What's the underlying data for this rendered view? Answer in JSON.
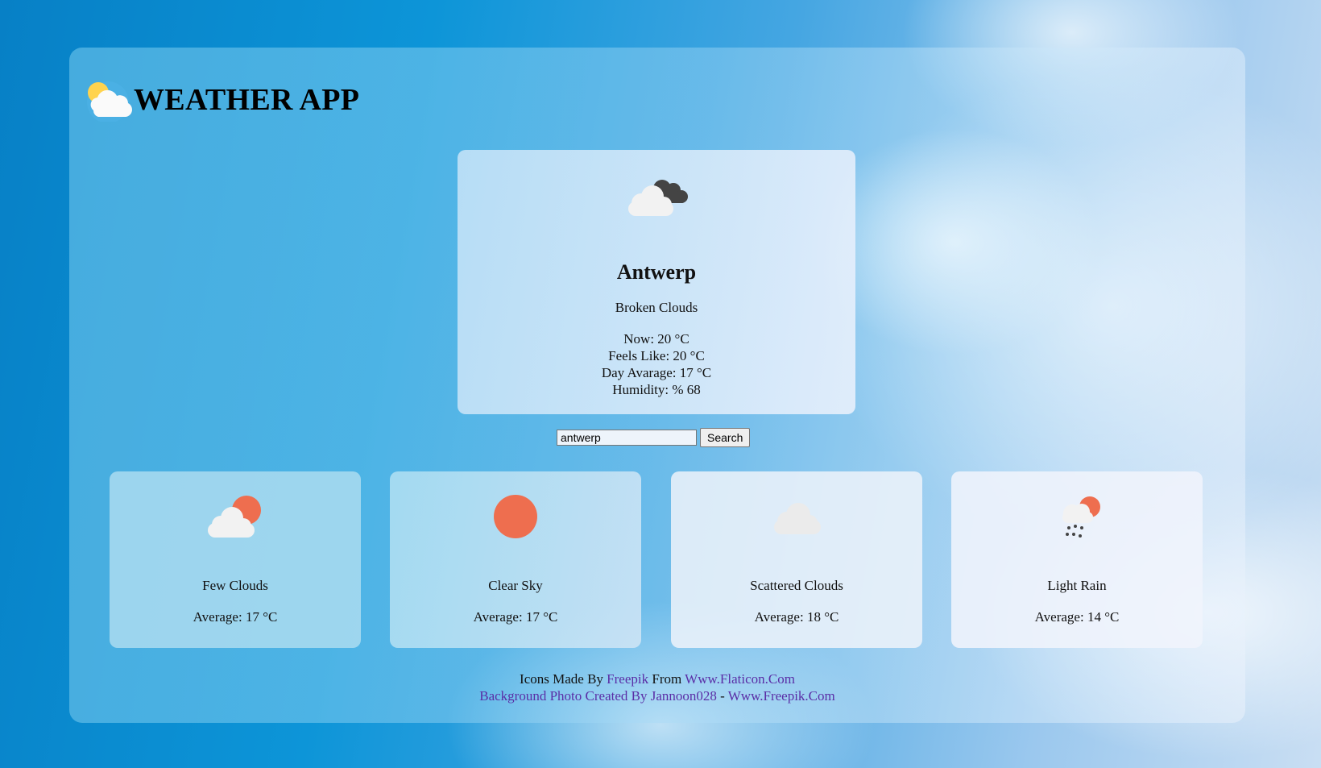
{
  "app": {
    "title": "WEATHER APP"
  },
  "current": {
    "city": "Antwerp",
    "description": "Broken Clouds",
    "now": "Now: 20 °C",
    "feels_like": "Feels Like: 20 °C",
    "day_average": "Day Avarage: 17 °C",
    "humidity": "Humidity: % 68",
    "icon": "broken-clouds-icon"
  },
  "search": {
    "value": "antwerp",
    "button_label": "Search"
  },
  "forecast": [
    {
      "description": "Few Clouds",
      "average": "Average: 17 °C",
      "icon": "few-clouds-icon"
    },
    {
      "description": "Clear Sky",
      "average": "Average: 17 °C",
      "icon": "clear-sky-icon"
    },
    {
      "description": "Scattered Clouds",
      "average": "Average: 18 °C",
      "icon": "scattered-clouds-icon"
    },
    {
      "description": "Light Rain",
      "average": "Average: 14 °C",
      "icon": "light-rain-icon"
    }
  ],
  "footer": {
    "line1_prefix": "Icons Made By ",
    "line1_link1": "Freepik",
    "line1_mid": " From ",
    "line1_link2": "Www.Flaticon.Com",
    "line2_link1": "Background Photo Created By Jannoon028",
    "line2_sep": " - ",
    "line2_link2": "Www.Freepik.Com"
  },
  "colors": {
    "sun": "#ee6e4f",
    "cloud": "#f2f2f2",
    "dark_cloud": "#444444",
    "link": "#5a2ea6"
  }
}
